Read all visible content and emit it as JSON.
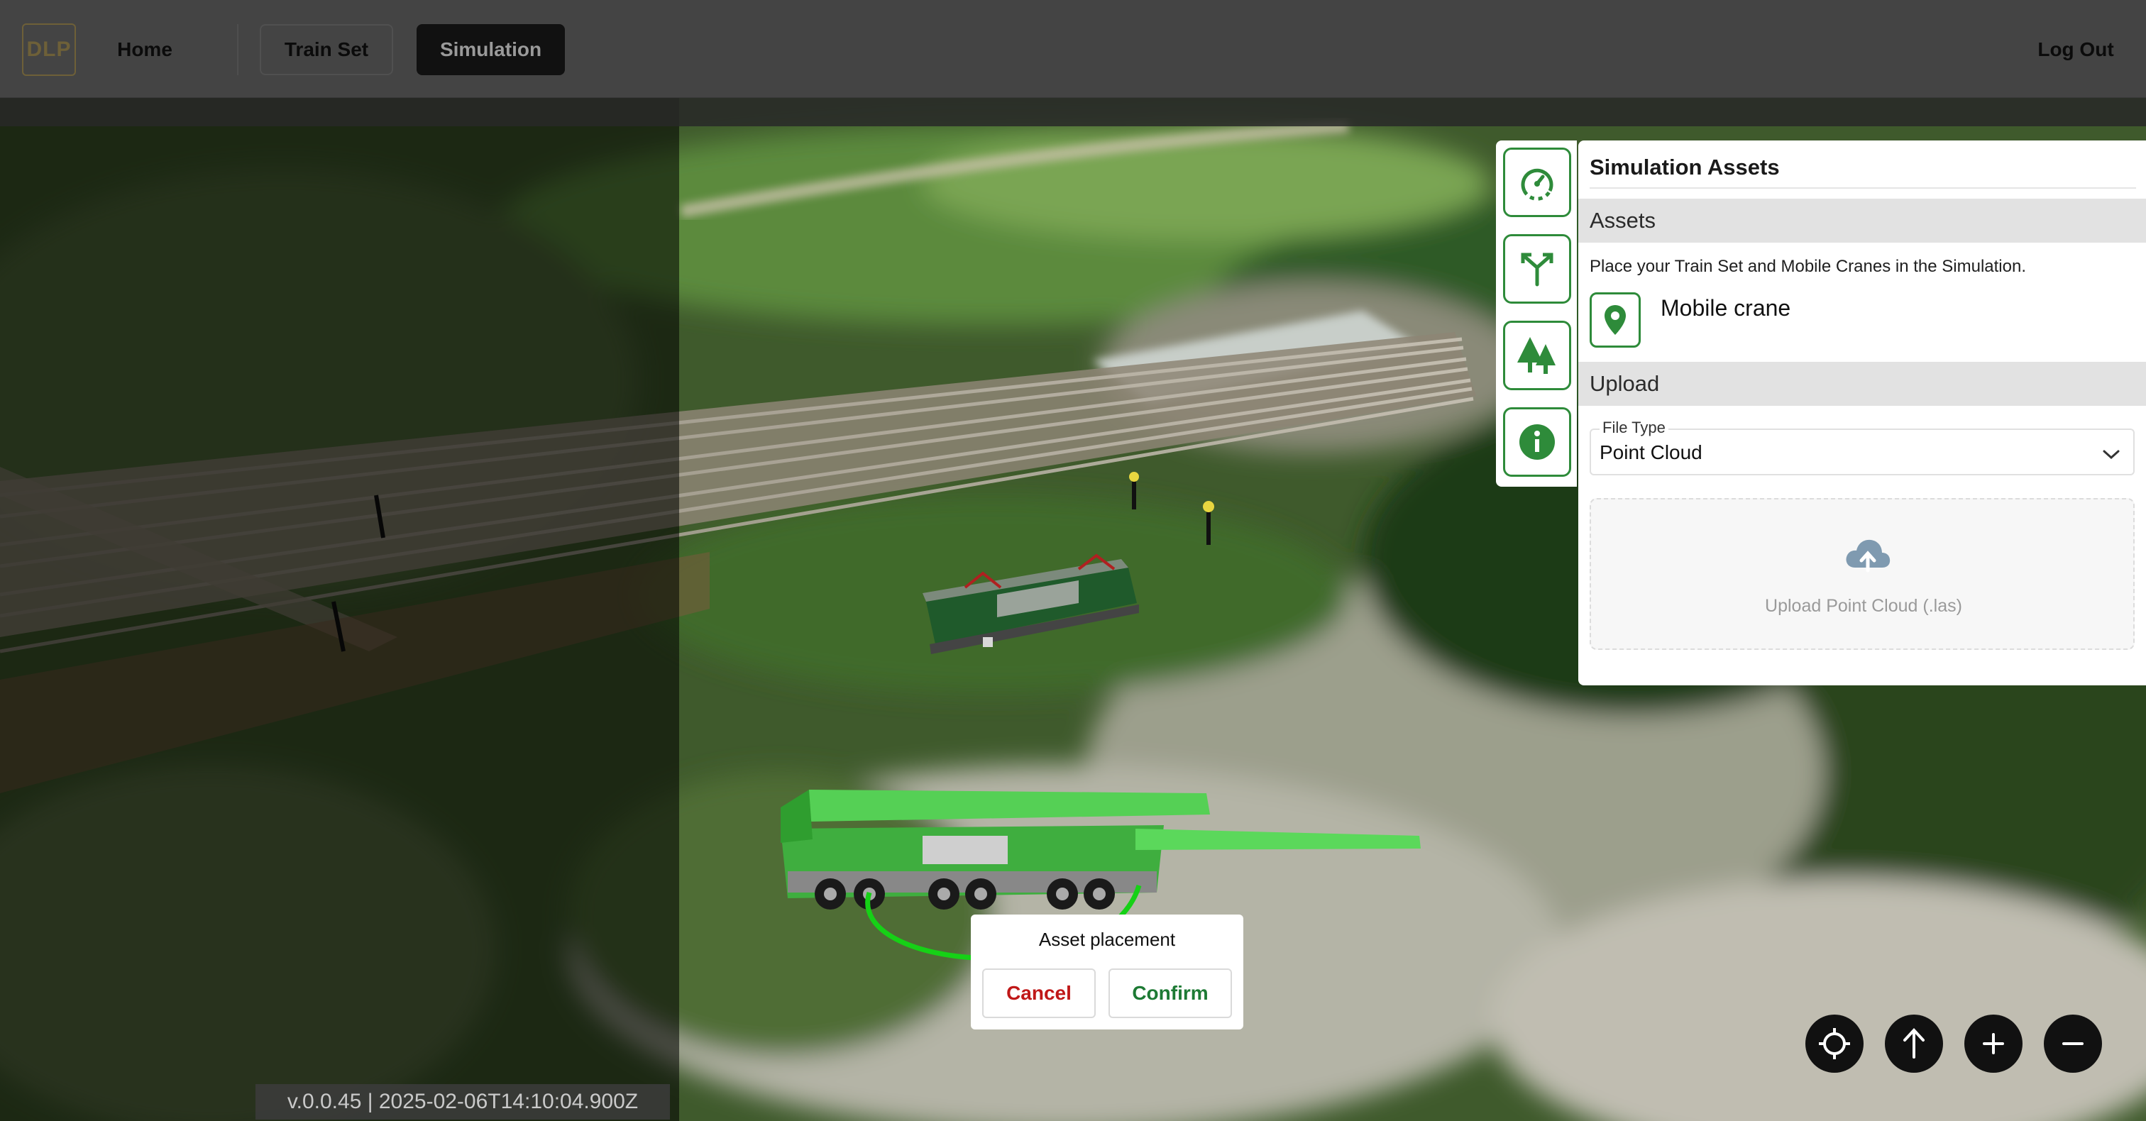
{
  "nav": {
    "logo_text": "DLP",
    "home": "Home",
    "train_set": "Train Set",
    "simulation": "Simulation",
    "logout": "Log Out"
  },
  "tools": [
    "speed-dial-icon",
    "route-branch-icon",
    "trees-icon",
    "info-icon"
  ],
  "panel": {
    "title": "Simulation Assets",
    "assets_header": "Assets",
    "assets_desc": "Place your Train Set and Mobile Cranes in the Simulation.",
    "asset_item": "Mobile crane",
    "upload_header": "Upload",
    "file_type_label": "File Type",
    "file_type_value": "Point Cloud",
    "upload_text": "Upload Point Cloud (.las)"
  },
  "dialog": {
    "title": "Asset placement",
    "cancel": "Cancel",
    "confirm": "Confirm"
  },
  "map_controls": [
    "locate-icon",
    "north-arrow-icon",
    "zoom-in-icon",
    "zoom-out-icon"
  ],
  "version": "v.0.0.45 | 2025-02-06T14:10:04.900Z",
  "colors": {
    "accent_green": "#2e8b3a",
    "cancel_red": "#c01818",
    "confirm_green": "#1d7a34",
    "topbar": "#444444"
  }
}
